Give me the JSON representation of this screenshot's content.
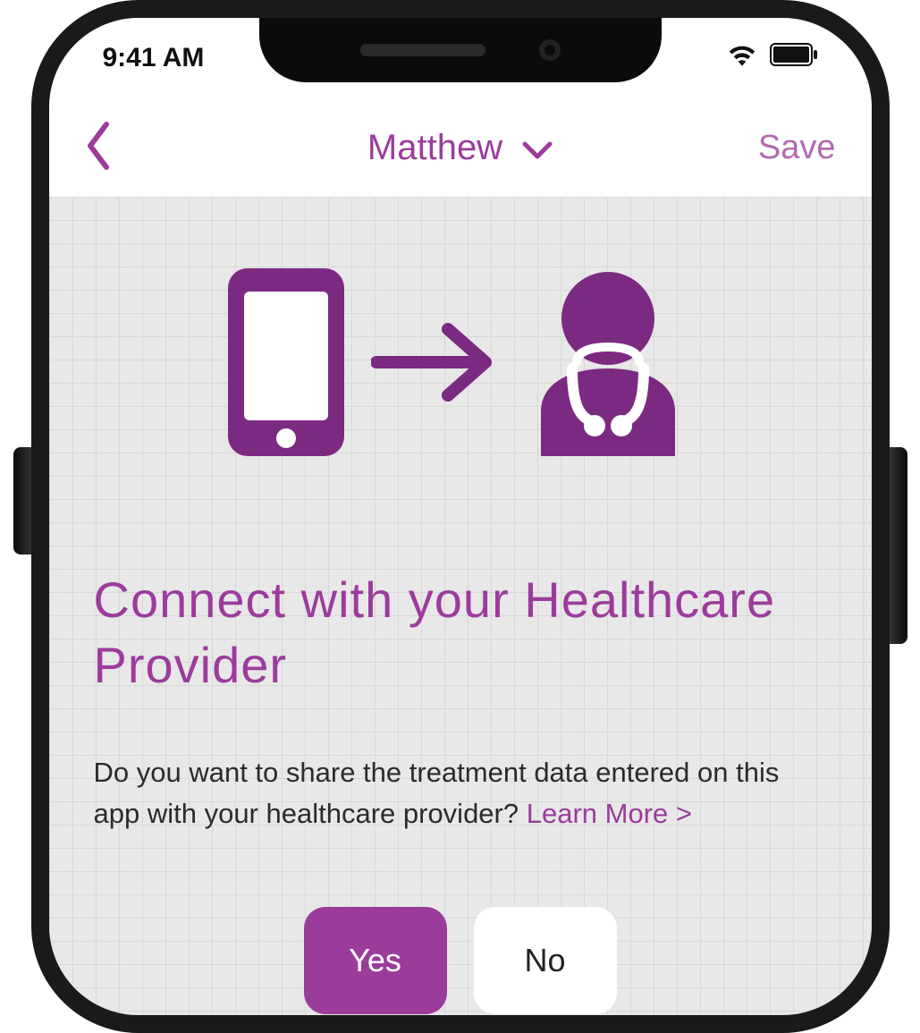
{
  "status": {
    "time": "9:41 AM"
  },
  "nav": {
    "title": "Matthew",
    "save_label": "Save"
  },
  "main": {
    "heading": "Connect with your Healthcare Provider",
    "body": "Do you want to share the treatment data entered on this app with your healthcare provider? ",
    "learn_more": "Learn More >",
    "yes_label": "Yes",
    "no_label": "No"
  },
  "colors": {
    "accent": "#9b3c9b"
  },
  "icons": {
    "back": "chevron-left-icon",
    "dropdown": "chevron-down-icon",
    "wifi": "wifi-icon",
    "battery": "battery-icon",
    "phone_graphic": "phone-icon",
    "arrow_graphic": "arrow-right-icon",
    "doctor_graphic": "doctor-icon"
  }
}
